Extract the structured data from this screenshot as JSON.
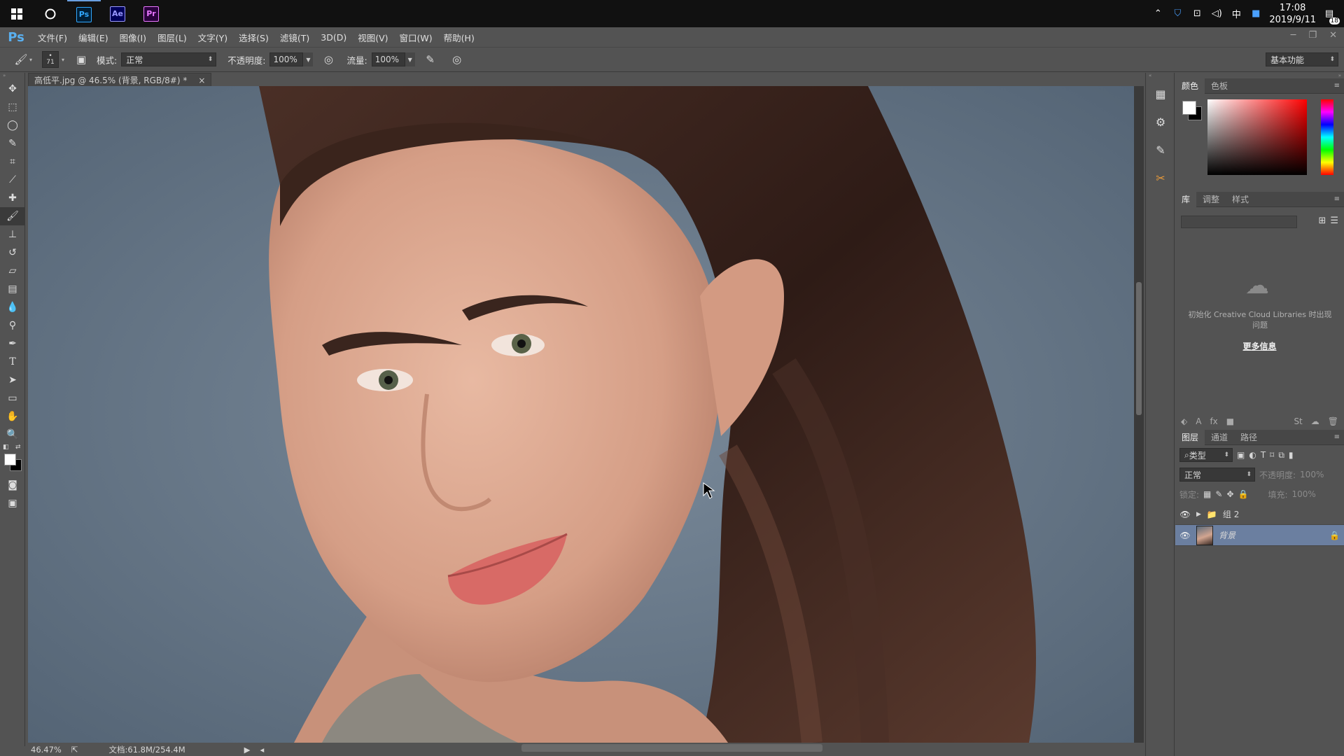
{
  "taskbar": {
    "apps": [
      {
        "name": "windows-start",
        "glyph": "⊞"
      },
      {
        "name": "search-circle",
        "glyph": "○"
      },
      {
        "name": "photoshop",
        "label": "Ps",
        "color": "#31a8ff",
        "bg": "#001e36"
      },
      {
        "name": "after-effects",
        "label": "Ae",
        "color": "#9999ff",
        "bg": "#00005b"
      },
      {
        "name": "premiere",
        "label": "Pr",
        "color": "#ea77ff",
        "bg": "#2a003d"
      }
    ],
    "clock_time": "17:08",
    "clock_date": "2019/9/11",
    "ime": "中",
    "notification_count": "18"
  },
  "menubar": {
    "logo": "Ps",
    "items": [
      "文件(F)",
      "编辑(E)",
      "图像(I)",
      "图层(L)",
      "文字(Y)",
      "选择(S)",
      "滤镜(T)",
      "3D(D)",
      "视图(V)",
      "窗口(W)",
      "帮助(H)"
    ]
  },
  "options": {
    "brush_size": "71",
    "mode_label": "模式:",
    "mode_value": "正常",
    "opacity_label": "不透明度:",
    "opacity_value": "100%",
    "flow_label": "流量:",
    "flow_value": "100%",
    "workspace": "基本功能"
  },
  "document": {
    "tab_title": "高低平.jpg @ 46.5% (背景, RGB/8#) *",
    "close": "×",
    "zoom": "46.47%",
    "doc_info": "文档:61.8M/254.4M"
  },
  "colors": {
    "accent": "#31a8ff",
    "selected_layer": "#6b7fa0",
    "panel_bg": "#535353",
    "dark_bg": "#3a3a3a"
  },
  "panels": {
    "color_tabs": [
      "颜色",
      "色板"
    ],
    "library_tabs": [
      "库",
      "调整",
      "样式"
    ],
    "library_message": "初始化 Creative Cloud Libraries 时出现问题",
    "library_more": "更多信息",
    "layers_tabs": [
      "图层",
      "通道",
      "路径"
    ],
    "layer_filter": "类型",
    "blend_mode": "正常",
    "opacity_label": "不透明度:",
    "opacity_value": "100%",
    "lock_label": "锁定:",
    "fill_label": "填充:",
    "fill_value": "100%",
    "layers": [
      {
        "name": "组 2",
        "type": "group"
      },
      {
        "name": "背景",
        "type": "image",
        "selected": true
      }
    ]
  }
}
